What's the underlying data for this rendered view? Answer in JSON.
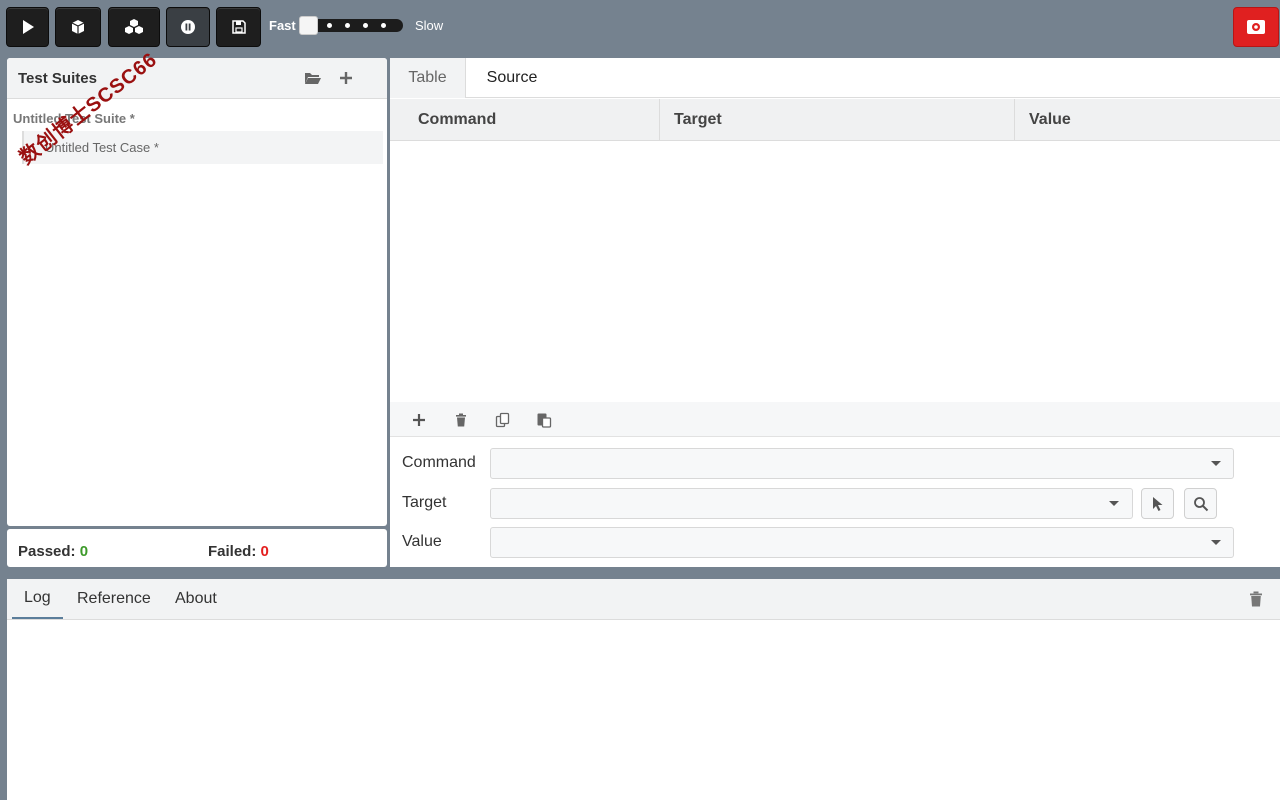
{
  "toolbar": {
    "buttons": [
      {
        "name": "play-test-case",
        "icon": "play-icon"
      },
      {
        "name": "play-test-suite",
        "icon": "cube-icon"
      },
      {
        "name": "play-all-suites",
        "icon": "cubes-icon"
      },
      {
        "name": "pause",
        "icon": "pause-icon"
      },
      {
        "name": "save",
        "icon": "save-icon"
      }
    ],
    "speed_fast_label": "Fast",
    "speed_slow_label": "Slow",
    "record_icon": "record-icon",
    "record_color": "#e02020"
  },
  "left": {
    "header_title": "Test Suites",
    "suite_name": "Untitled Test Suite *",
    "case_name": "Untitled Test Case *"
  },
  "status": {
    "passed_label": "Passed:",
    "passed_value": "0",
    "failed_label": "Failed:",
    "failed_value": "0",
    "passed_color": "#3d9a2a",
    "failed_color": "#e41f1f"
  },
  "editor": {
    "tabs": [
      {
        "label": "Table"
      },
      {
        "label": "Source"
      }
    ],
    "columns": [
      "Command",
      "Target",
      "Value"
    ],
    "form": {
      "command_label": "Command",
      "target_label": "Target",
      "value_label": "Value",
      "command_value": "",
      "target_value": "",
      "value_value": ""
    }
  },
  "bottom": {
    "tabs": [
      {
        "label": "Log"
      },
      {
        "label": "Reference"
      },
      {
        "label": "About"
      }
    ]
  },
  "watermark": "数创博士SCSC66"
}
